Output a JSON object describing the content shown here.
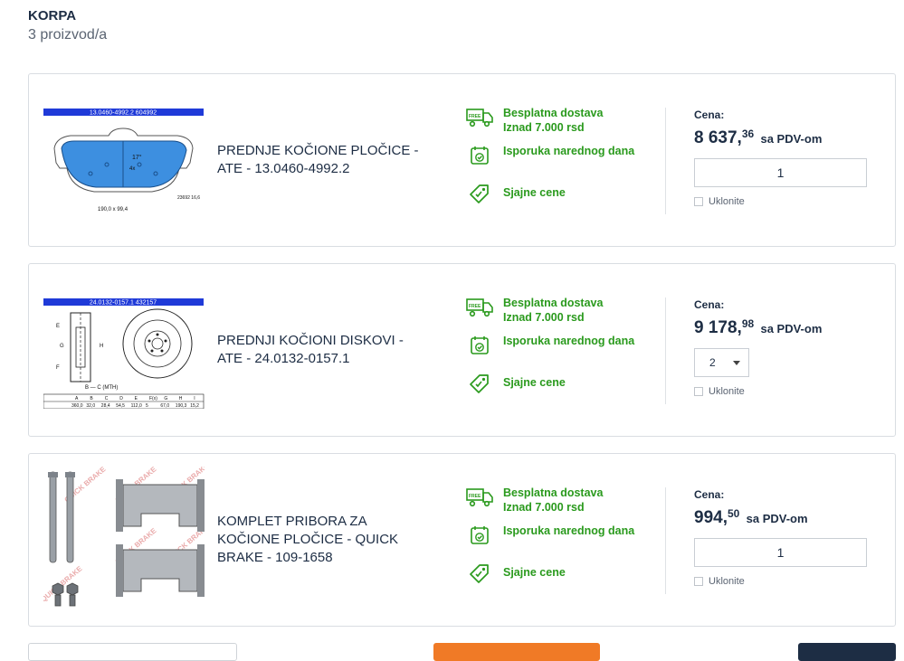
{
  "cart": {
    "title": "KORPA",
    "count": "3 proizvod/a"
  },
  "items": [
    {
      "image_caption_top": "13.0460-4992.2    604992",
      "image_caption_bottom": "190,0 x 99,4",
      "image_code_side": "23692 16,6",
      "name": "PREDNJE KOČIONE PLOČICE - ATE - 13.0460-4992.2",
      "perks": [
        "Besplatna dostava\nIznad 7.000 rsd",
        "Isporuka narednog dana",
        "Sjajne cene"
      ],
      "price_label": "Cena:",
      "price_main": "8 637,",
      "price_dec": "36",
      "vat": "sa PDV-om",
      "qty": "1",
      "remove": "Uklonite"
    },
    {
      "image_caption_top": "24.0132-0157.1    432157",
      "table_headers": [
        "A",
        "B",
        "C",
        "D",
        "E",
        "F(x)",
        "G",
        "H",
        "I"
      ],
      "table_values": [
        "360,0",
        "32,0",
        "28,4",
        "54,5",
        "112,0",
        "5",
        "67,0",
        "190,3",
        "15,2"
      ],
      "name": "PREDNJI KOČIONI DISKOVI - ATE - 24.0132-0157.1",
      "perks": [
        "Besplatna dostava\nIznad 7.000 rsd",
        "Isporuka narednog dana",
        "Sjajne cene"
      ],
      "price_label": "Cena:",
      "price_main": "9 178,",
      "price_dec": "98",
      "vat": "sa PDV-om",
      "qty": "2",
      "remove": "Uklonite"
    },
    {
      "brand_watermark": "QUICK BRAKE",
      "name": "KOMPLET PRIBORA ZA KOČIONE PLOČICE - QUICK BRAKE - 109-1658",
      "perks": [
        "Besplatna dostava\nIznad 7.000 rsd",
        "Isporuka narednog dana",
        "Sjajne cene"
      ],
      "price_label": "Cena:",
      "price_main": "994,",
      "price_dec": "50",
      "vat": "sa PDV-om",
      "qty": "1",
      "remove": "Uklonite"
    }
  ],
  "icons": {
    "free": "free-delivery-truck-icon",
    "calendar": "calendar-check-icon",
    "tag": "price-tag-icon"
  },
  "colors": {
    "accent_green": "#2a9a1d",
    "orange": "#f07a26",
    "dark": "#1d2d44",
    "blue_part": "#4a90d9"
  }
}
